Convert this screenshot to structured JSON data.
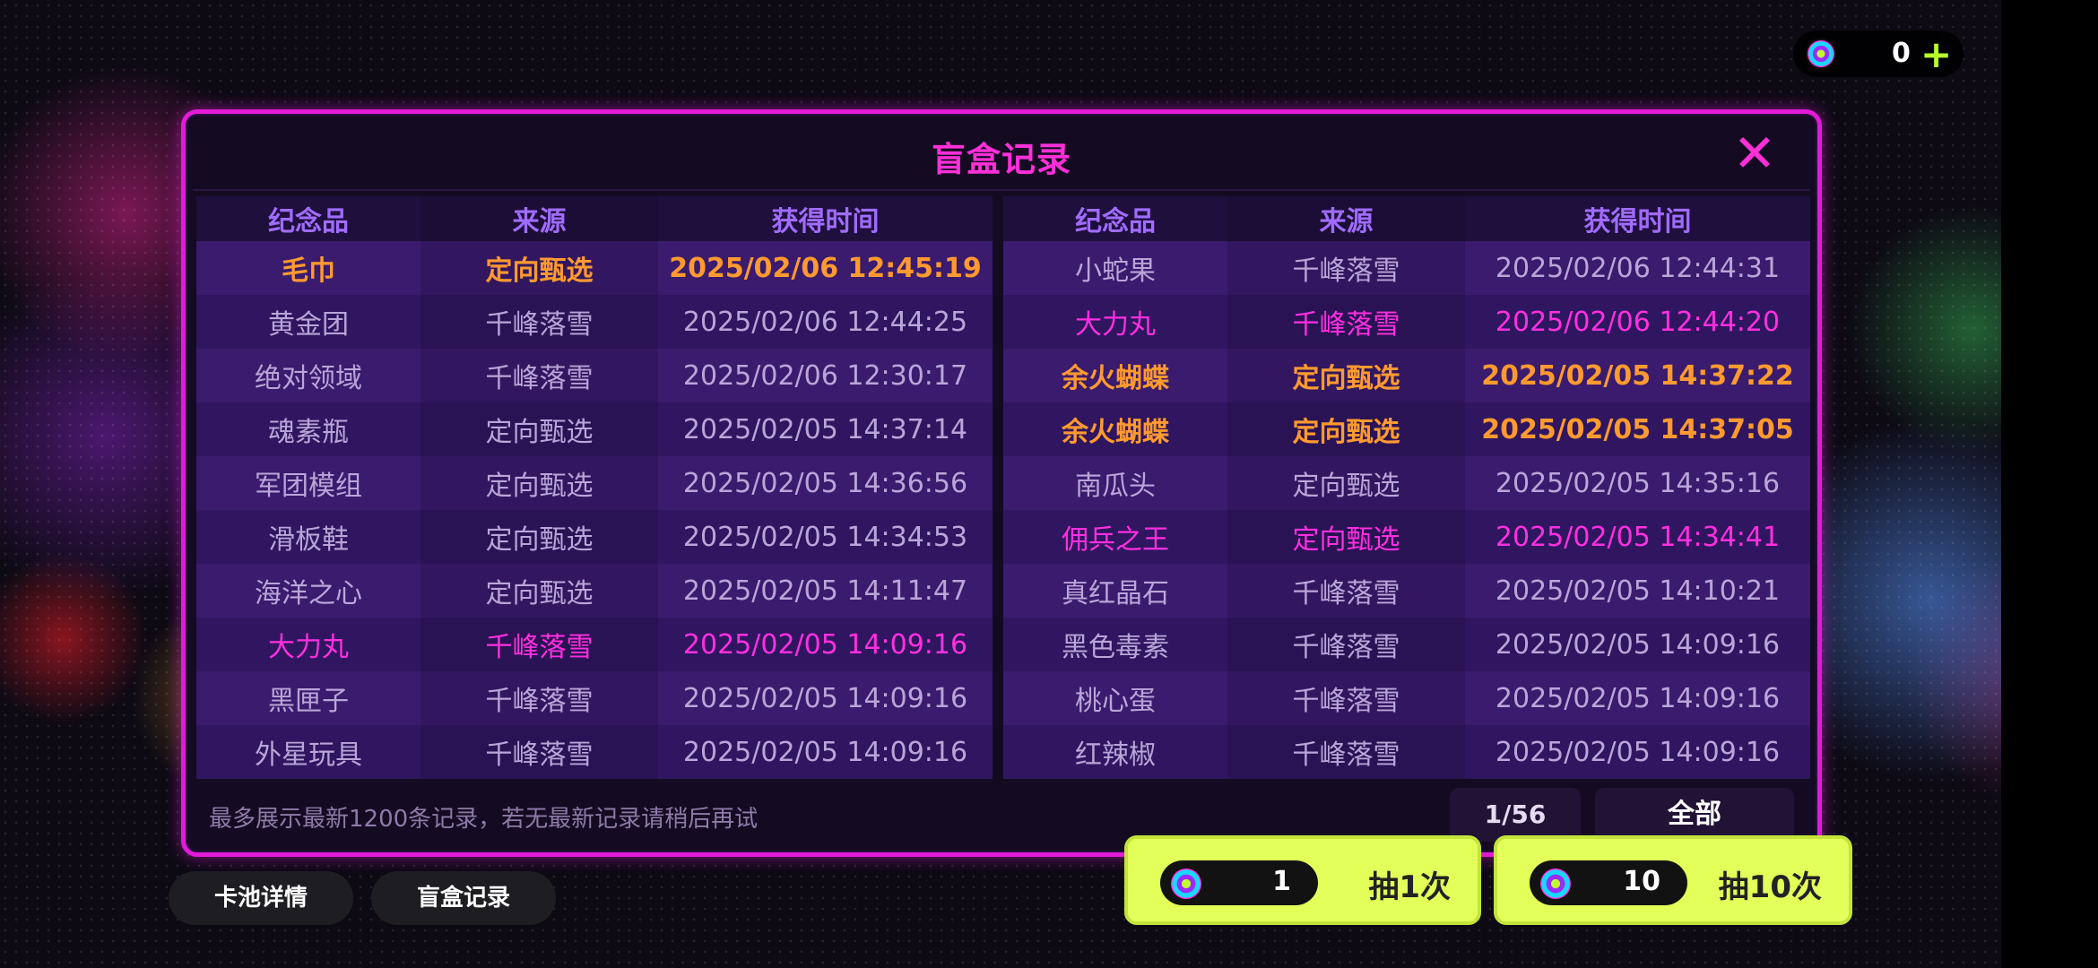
{
  "currency": {
    "icon": "gem-coin-icon",
    "amount": "0",
    "add": "+"
  },
  "dialog": {
    "title": "盲盒记录",
    "close": "✕",
    "headers": [
      "纪念品",
      "来源",
      "获得时间"
    ],
    "left_rows": [
      {
        "item": "毛巾",
        "source": "定向甄选",
        "time": "2025/02/06 12:45:19",
        "style": "orange"
      },
      {
        "item": "黄金团",
        "source": "千峰落雪",
        "time": "2025/02/06 12:44:25",
        "style": "normal"
      },
      {
        "item": "绝对领域",
        "source": "千峰落雪",
        "time": "2025/02/06 12:30:17",
        "style": "normal"
      },
      {
        "item": "魂素瓶",
        "source": "定向甄选",
        "time": "2025/02/05 14:37:14",
        "style": "normal"
      },
      {
        "item": "军团模组",
        "source": "定向甄选",
        "time": "2025/02/05 14:36:56",
        "style": "normal"
      },
      {
        "item": "滑板鞋",
        "source": "定向甄选",
        "time": "2025/02/05 14:34:53",
        "style": "normal"
      },
      {
        "item": "海洋之心",
        "source": "定向甄选",
        "time": "2025/02/05 14:11:47",
        "style": "normal"
      },
      {
        "item": "大力丸",
        "source": "千峰落雪",
        "time": "2025/02/05 14:09:16",
        "style": "pink"
      },
      {
        "item": "黑匣子",
        "source": "千峰落雪",
        "time": "2025/02/05 14:09:16",
        "style": "normal"
      },
      {
        "item": "外星玩具",
        "source": "千峰落雪",
        "time": "2025/02/05 14:09:16",
        "style": "normal"
      }
    ],
    "right_rows": [
      {
        "item": "小蛇果",
        "source": "千峰落雪",
        "time": "2025/02/06 12:44:31",
        "style": "normal"
      },
      {
        "item": "大力丸",
        "source": "千峰落雪",
        "time": "2025/02/06 12:44:20",
        "style": "pink"
      },
      {
        "item": "余火蝴蝶",
        "source": "定向甄选",
        "time": "2025/02/05 14:37:22",
        "style": "orange"
      },
      {
        "item": "余火蝴蝶",
        "source": "定向甄选",
        "time": "2025/02/05 14:37:05",
        "style": "orange"
      },
      {
        "item": "南瓜头",
        "source": "定向甄选",
        "time": "2025/02/05 14:35:16",
        "style": "normal"
      },
      {
        "item": "佣兵之王",
        "source": "定向甄选",
        "time": "2025/02/05 14:34:41",
        "style": "pink"
      },
      {
        "item": "真红晶石",
        "source": "千峰落雪",
        "time": "2025/02/05 14:10:21",
        "style": "normal"
      },
      {
        "item": "黑色毒素",
        "source": "千峰落雪",
        "time": "2025/02/05 14:09:16",
        "style": "normal"
      },
      {
        "item": "桃心蛋",
        "source": "千峰落雪",
        "time": "2025/02/05 14:09:16",
        "style": "normal"
      },
      {
        "item": "红辣椒",
        "source": "千峰落雪",
        "time": "2025/02/05 14:09:16",
        "style": "normal"
      }
    ],
    "footer_note": "最多展示最新1200条记录，若无最新记录请稍后再试",
    "page": "1/56",
    "filter_button": "全部"
  },
  "bottom": {
    "pool_details": "卡池详情",
    "box_records": "盲盒记录",
    "draw_one": {
      "cost": "1",
      "label": "抽1次"
    },
    "draw_ten": {
      "cost": "10",
      "label": "抽10次"
    }
  },
  "colors": {
    "accent": "#e21bd8",
    "highlight_orange": "#ff9a30",
    "highlight_pink": "#ff2fe0",
    "draw_button": "#e3ff5a"
  }
}
